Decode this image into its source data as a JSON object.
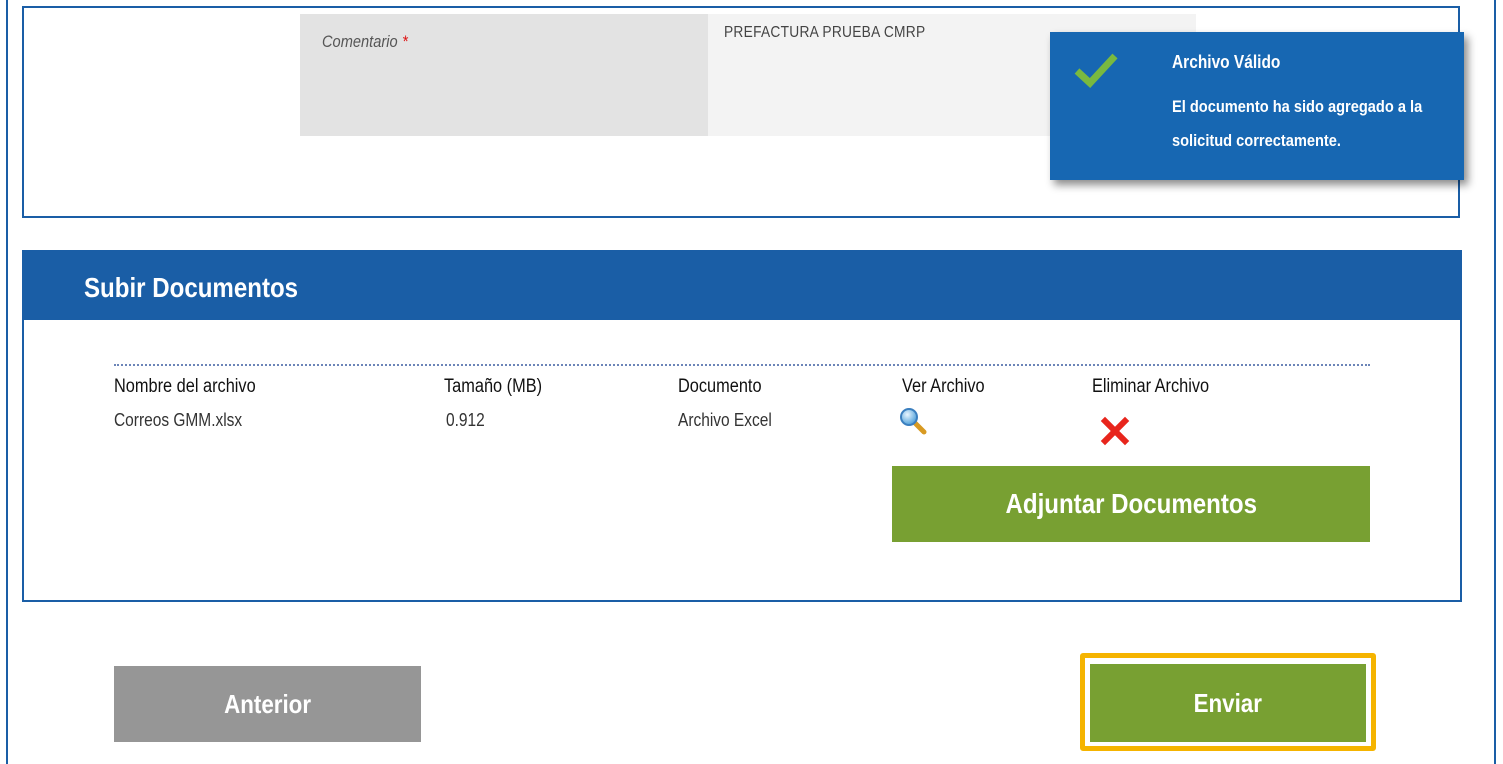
{
  "form": {
    "comment_label": "Comentario",
    "required_mark": "*",
    "comment_value": "PREFACTURA PRUEBA CMRP"
  },
  "toast": {
    "icon": "check-icon",
    "title": "Archivo Válido",
    "message": "El documento ha sido agregado a la solicitud correctamente."
  },
  "upload": {
    "title": "Subir Documentos",
    "columns": {
      "name": "Nombre del archivo",
      "size": "Tamaño (MB)",
      "type": "Documento",
      "view": "Ver Archivo",
      "delete": "Eliminar Archivo"
    },
    "files": [
      {
        "name": "Correos GMM.xlsx",
        "size": "0.912",
        "type": "Archivo Excel",
        "view_icon": "magnifier-icon",
        "delete_icon": "red-x-icon"
      }
    ],
    "attach_label": "Adjuntar Documentos"
  },
  "nav": {
    "prev_label": "Anterior",
    "send_label": "Enviar"
  },
  "colors": {
    "primary_blue": "#1a5ea6",
    "toast_blue": "#1767b2",
    "green": "#78a032",
    "gray_button": "#969696",
    "highlight": "#f5b400",
    "delete_red": "#e8251c"
  }
}
